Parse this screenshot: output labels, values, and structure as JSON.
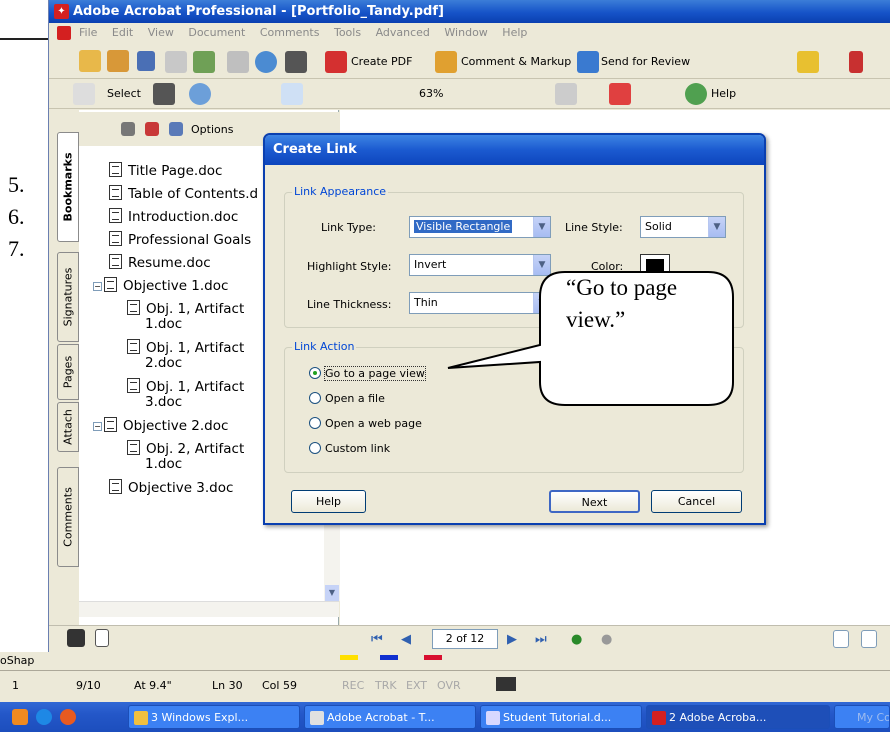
{
  "slide": {
    "numbers": [
      "5.",
      "6.",
      "7."
    ],
    "left_fragment": "oShap",
    "left_status_num": "1"
  },
  "window": {
    "title": "Adobe Acrobat Professional - [Portfolio_Tandy.pdf]"
  },
  "menu": [
    "File",
    "Edit",
    "View",
    "Document",
    "Comments",
    "Tools",
    "Advanced",
    "Window",
    "Help"
  ],
  "toolbar1": {
    "create_pdf": "Create PDF",
    "comment_markup": "Comment & Markup",
    "send_review": "Send for Review"
  },
  "toolbar2": {
    "select": "Select",
    "zoom": "63%",
    "help": "Help"
  },
  "nav_tabs": [
    "Bookmarks",
    "Signatures",
    "Pages",
    "Attach",
    "Comments"
  ],
  "bookmark_toolbar": {
    "options": "Options"
  },
  "bookmarks": [
    "Title Page.doc",
    "Table of Contents.d",
    "Introduction.doc",
    "Professional Goals",
    "Resume.doc",
    "Objective 1.doc",
    "Obj. 1, Artifact",
    "1.doc",
    "Obj. 1, Artifact",
    "2.doc",
    "Obj. 1, Artifact",
    "3.doc",
    "Objective 2.doc",
    "Obj. 2, Artifact",
    "1.doc",
    "Objective 3.doc"
  ],
  "page_nav": {
    "page": "2 of 12"
  },
  "dialog": {
    "title": "Create Link",
    "appearance_group": "Link Appearance",
    "link_type_label": "Link Type:",
    "link_type_value": "Visible Rectangle",
    "line_style_label": "Line Style:",
    "line_style_value": "Solid",
    "highlight_label": "Highlight Style:",
    "highlight_value": "Invert",
    "color_label": "Color:",
    "thickness_label": "Line Thickness:",
    "thickness_value": "Thin",
    "action_group": "Link Action",
    "actions": [
      "Go to a page view",
      "Open a file",
      "Open a web page",
      "Custom link"
    ],
    "selected_action": 0,
    "help_button": "Help",
    "next_button": "Next",
    "cancel_button": "Cancel"
  },
  "callout": {
    "text": "“Go to page view.”"
  },
  "statusbar": {
    "page": "9/10",
    "at": "At 9.4\"",
    "ln": "Ln 30",
    "col": "Col 59",
    "rec": "REC",
    "trk": "TRK",
    "ext": "EXT",
    "ovr": "OVR"
  },
  "taskbar": {
    "items": [
      "3 Windows Expl...",
      "Adobe Acrobat - T...",
      "Student Tutorial.d...",
      "2 Adobe Acroba...",
      "My Comp"
    ]
  }
}
